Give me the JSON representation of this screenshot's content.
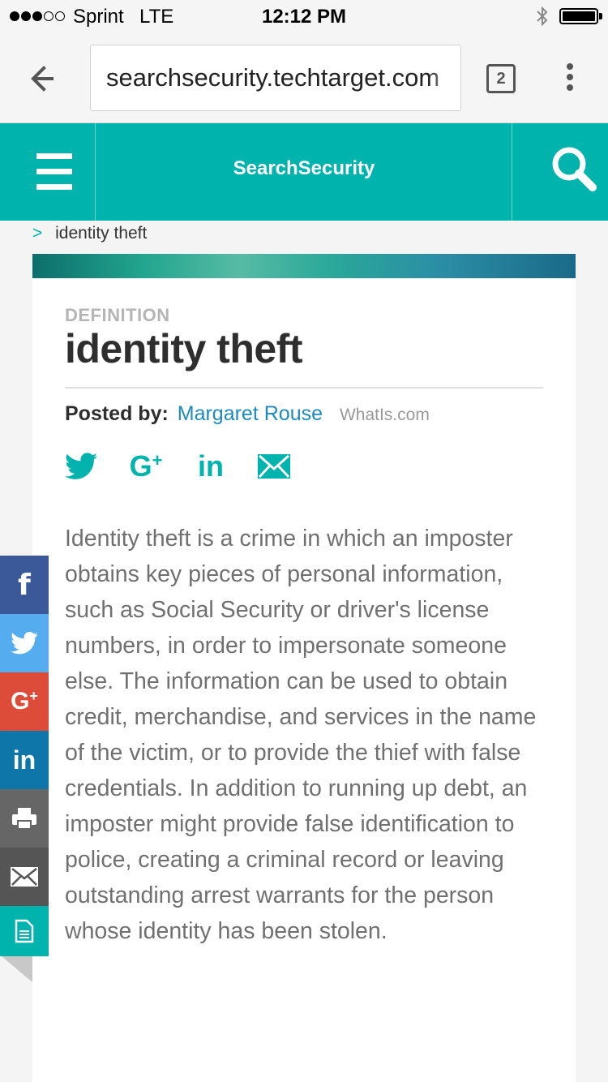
{
  "status_bar": {
    "carrier": "Sprint",
    "network": "LTE",
    "time": "12:12 PM",
    "signal_bars_filled": 3,
    "signal_bars_total": 5
  },
  "browser": {
    "url": "searchsecurity.techtarget.com",
    "tab_count": "2"
  },
  "header": {
    "title": "SearchSecurity",
    "accent_color": "#00b3ad"
  },
  "breadcrumb": {
    "chevron": ">",
    "current": "identity theft"
  },
  "article": {
    "label": "DEFINITION",
    "title": "identity theft",
    "posted_by_label": "Posted by:",
    "author": "Margaret Rouse",
    "source": "WhatIs.com",
    "share_icons": [
      "twitter-icon",
      "google-plus-icon",
      "linkedin-icon",
      "email-icon"
    ],
    "share_gplus_text": "G",
    "share_linkedin_text": "in",
    "body": "Identity theft is a crime in which an imposter obtains key pieces of personal information, such as Social Security or driver's license numbers, in order to impersonate someone else. The information can be used to obtain credit, merchandise, and services in the name of the victim, or to provide the thief with false credentials. In addition to running up debt, an imposter might provide false identification to police, creating a criminal record or leaving outstanding arrest warrants for the person whose identity has been stolen."
  },
  "side_share": {
    "facebook_text": "f",
    "gplus_text": "G",
    "linkedin_text": "in",
    "icons": [
      "facebook-icon",
      "twitter-icon",
      "google-plus-icon",
      "linkedin-icon",
      "print-icon",
      "email-icon",
      "document-icon"
    ],
    "colors": {
      "facebook": "#3b5998",
      "twitter": "#55acee",
      "google_plus": "#dd4b39",
      "linkedin": "#0e76a8",
      "print": "#666666",
      "email": "#555555",
      "document": "#00b3ad"
    }
  }
}
